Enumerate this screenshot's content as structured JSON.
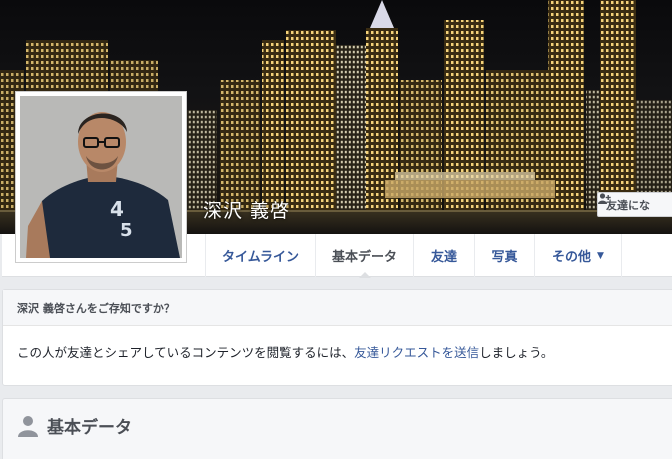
{
  "profile": {
    "name": "深沢 義啓"
  },
  "cover": {
    "add_friend_label": "友達にな"
  },
  "tabs": [
    {
      "label": "タイムライン"
    },
    {
      "label": "基本データ"
    },
    {
      "label": "友達"
    },
    {
      "label": "写真"
    },
    {
      "label": "その他"
    }
  ],
  "know_card": {
    "question": "深沢 義啓さんをご存知ですか？",
    "body_before": "この人が友達とシェアしているコンテンツを閲覧するには、",
    "link": "友達リクエストを送信",
    "body_after": "しましょう。"
  },
  "about_card": {
    "title": "基本データ"
  },
  "colors": {
    "link": "#365899",
    "background": "#e9ebee",
    "text_dark": "#1d2129",
    "text_muted": "#4b4f56"
  },
  "icons": [
    "add-friend-icon",
    "chevron-down-icon",
    "person-silhouette-icon"
  ]
}
